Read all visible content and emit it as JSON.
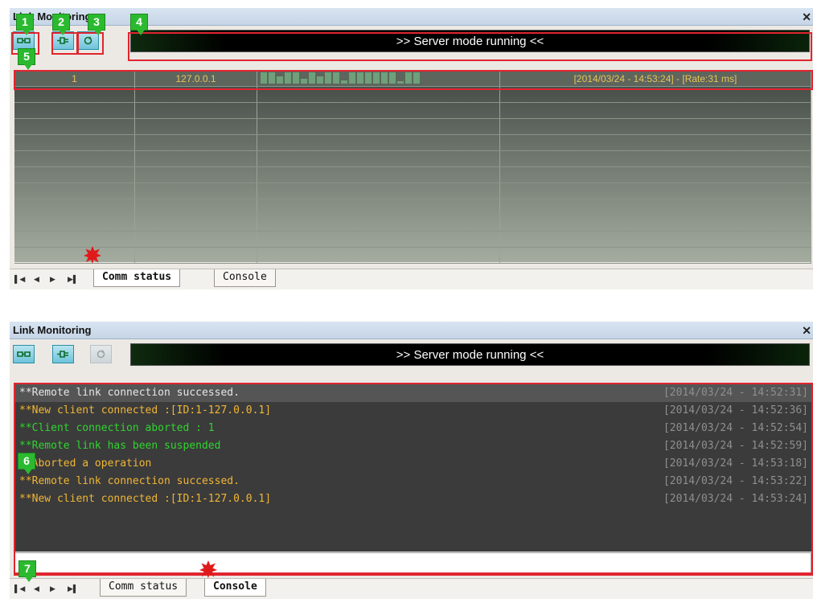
{
  "top_panel": {
    "title": "Link Monitoring",
    "status_text": ">> Server mode running <<",
    "grid": {
      "row": {
        "id": "1",
        "ip": "127.0.0.1",
        "activity": [
          0.85,
          0.85,
          0.55,
          0.85,
          0.85,
          0.4,
          0.85,
          0.55,
          0.85,
          0.85,
          0.25,
          0.85,
          0.85,
          0.85,
          0.85,
          0.85,
          0.85,
          0.2,
          0.85,
          0.85
        ],
        "info": "[2014/03/24 - 14:53:24] - [Rate:31 ms]"
      },
      "empty_rows": 11
    },
    "tabs": [
      "Comm status",
      "Console"
    ],
    "active_tab": "Comm status"
  },
  "bottom_panel": {
    "title": "Link Monitoring",
    "status_text": ">> Server mode running <<",
    "console_lines": [
      {
        "text": "**Remote link connection successed.",
        "time": "[2014/03/24 - 14:52:31]",
        "color": "#e6e6e6"
      },
      {
        "text": "**New client connected :[ID:1-127.0.0.1]",
        "time": "[2014/03/24 - 14:52:36]",
        "color": "#f0b636"
      },
      {
        "text": "**Client connection aborted : 1",
        "time": "[2014/03/24 - 14:52:54]",
        "color": "#2fd52f"
      },
      {
        "text": "**Remote link has been suspended",
        "time": "[2014/03/24 - 14:52:59]",
        "color": "#2fd52f"
      },
      {
        "text": "**Aborted a operation",
        "time": "[2014/03/24 - 14:53:18]",
        "color": "#f0b636"
      },
      {
        "text": "**Remote link connection successed.",
        "time": "[2014/03/24 - 14:53:22]",
        "color": "#f0b636"
      },
      {
        "text": "**New client connected :[ID:1-127.0.0.1]",
        "time": "[2014/03/24 - 14:53:24]",
        "color": "#f0b636"
      }
    ],
    "tabs": [
      "Comm status",
      "Console"
    ],
    "active_tab": "Console"
  },
  "annotations": [
    "1",
    "2",
    "3",
    "4",
    "5",
    "6",
    "7"
  ],
  "icons": {
    "connect": "link-toggle-icon",
    "plug": "plug-icon",
    "reset": "refresh-icon"
  },
  "colors": {
    "highlight_frame": "#e0252f",
    "badge": "#2bba2f",
    "grid_text": "#e8c45a"
  }
}
